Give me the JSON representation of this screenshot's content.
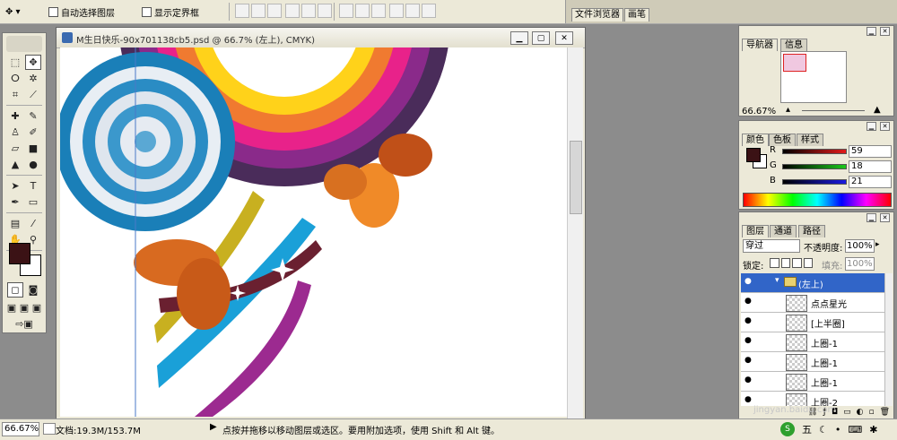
{
  "options_bar": {
    "auto_select_label": "自动选择图层",
    "show_bounds_label": "显示定界框"
  },
  "palette_well": {
    "tabs": [
      "文件浏览器",
      "画笔"
    ]
  },
  "document": {
    "title": "M生日快乐-90x701138cb5.psd @ 66.7% (左上), CMYK)"
  },
  "status_bar": {
    "zoom": "66.67%",
    "doc_info": "文档:19.3M/153.7M",
    "hint": "点按并拖移以移动图层或选区。要用附加选项，使用 Shift 和 Alt 键。"
  },
  "navigator": {
    "tabs": [
      "导航器",
      "信息"
    ],
    "zoom": "66.67%"
  },
  "color": {
    "tabs": [
      "颜色",
      "色板",
      "样式"
    ],
    "channels": [
      {
        "label": "R",
        "value": "59",
        "color": "#c0302a"
      },
      {
        "label": "G",
        "value": "18",
        "color": "#3aa83a"
      },
      {
        "label": "B",
        "value": "21",
        "color": "#3a40c0"
      }
    ],
    "foreground": "#3b1215"
  },
  "layers": {
    "tabs": [
      "图层",
      "通道",
      "路径"
    ],
    "blend_mode": "穿过",
    "opacity_label": "不透明度:",
    "opacity_value": "100%",
    "lock_label": "锁定:",
    "fill_label": "填充:",
    "fill_value": "100%",
    "group_name": "(左上)",
    "rows": [
      "点点星光",
      "[上半圈]",
      "上圈-1",
      "上圈-1",
      "上圈-1",
      "上圈-2"
    ]
  },
  "tray": {
    "ime": "五"
  },
  "watermark": {
    "text": "jingyan.baidu.com"
  },
  "colors": {
    "chrome": "#ece9d8",
    "workspace": "#8c8c8c",
    "selected_layer": "#3165c8"
  }
}
